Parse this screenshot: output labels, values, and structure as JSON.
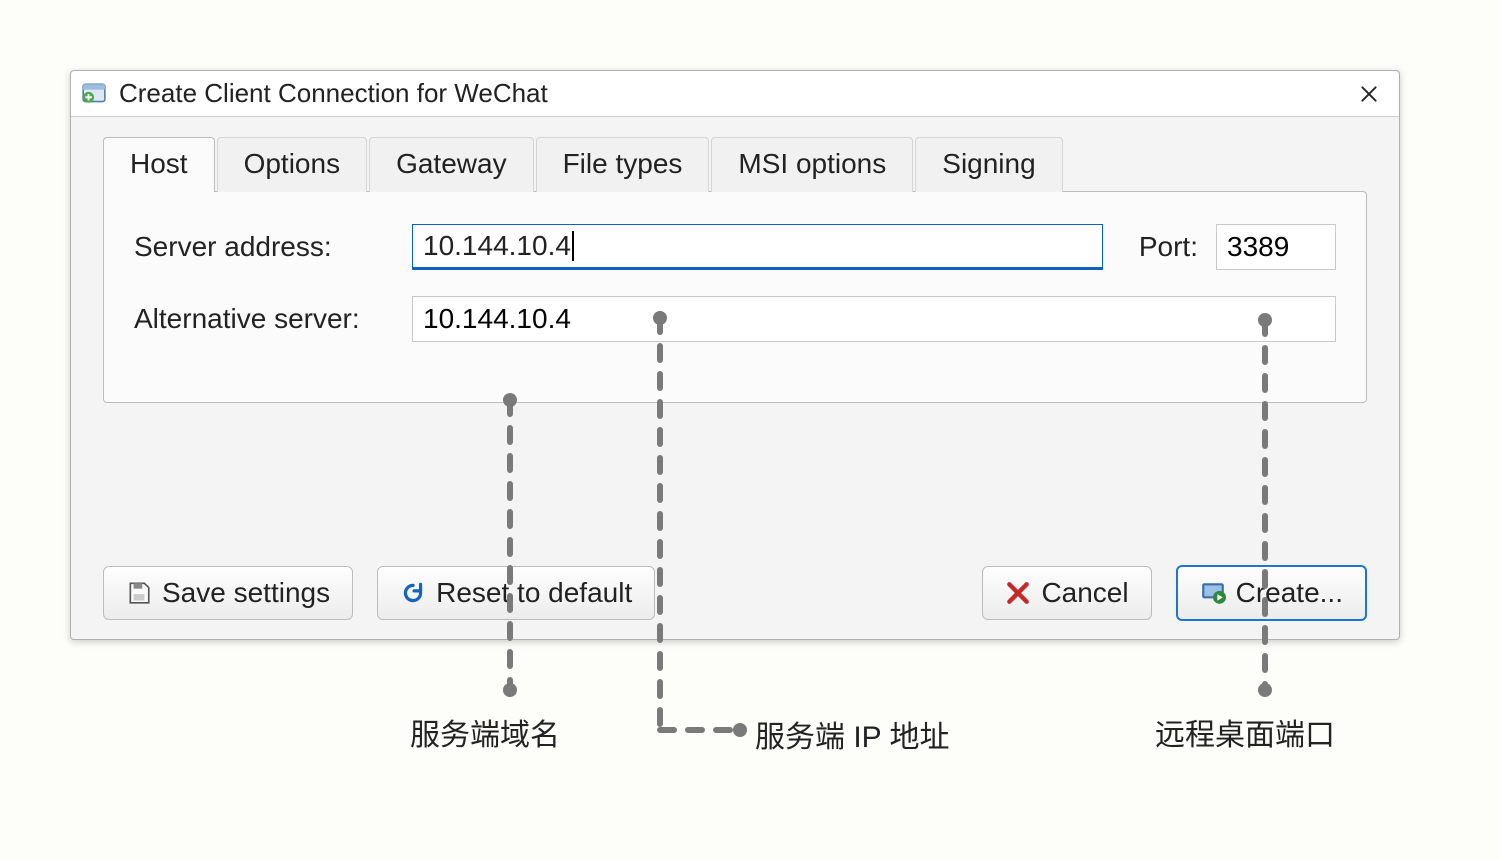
{
  "window": {
    "title": "Create Client Connection for WeChat"
  },
  "tabs": {
    "items": [
      {
        "label": "Host",
        "active": true
      },
      {
        "label": "Options",
        "active": false
      },
      {
        "label": "Gateway",
        "active": false
      },
      {
        "label": "File types",
        "active": false
      },
      {
        "label": "MSI options",
        "active": false
      },
      {
        "label": "Signing",
        "active": false
      }
    ]
  },
  "host_tab": {
    "server_address_label": "Server address:",
    "server_address_value": "10.144.10.4",
    "port_label": "Port:",
    "port_value": "3389",
    "alt_server_label": "Alternative server:",
    "alt_server_value": "10.144.10.4"
  },
  "buttons": {
    "save": "Save settings",
    "reset": "Reset to default",
    "cancel": "Cancel",
    "create": "Create..."
  },
  "annotations": {
    "server_domain": "服务端域名",
    "server_ip": "服务端 IP 地址",
    "rdp_port": "远程桌面端口"
  },
  "icons": {
    "app": "window-plus-icon",
    "close": "close-icon",
    "save": "floppy-icon",
    "reset": "refresh-icon",
    "cancel": "x-red-icon",
    "create": "monitor-play-icon"
  },
  "colors": {
    "focus_blue": "#0a63c2",
    "primary_border": "#1e74d1",
    "cancel_red": "#c62828",
    "reset_blue": "#1565c0",
    "create_green": "#2e8b3d"
  }
}
